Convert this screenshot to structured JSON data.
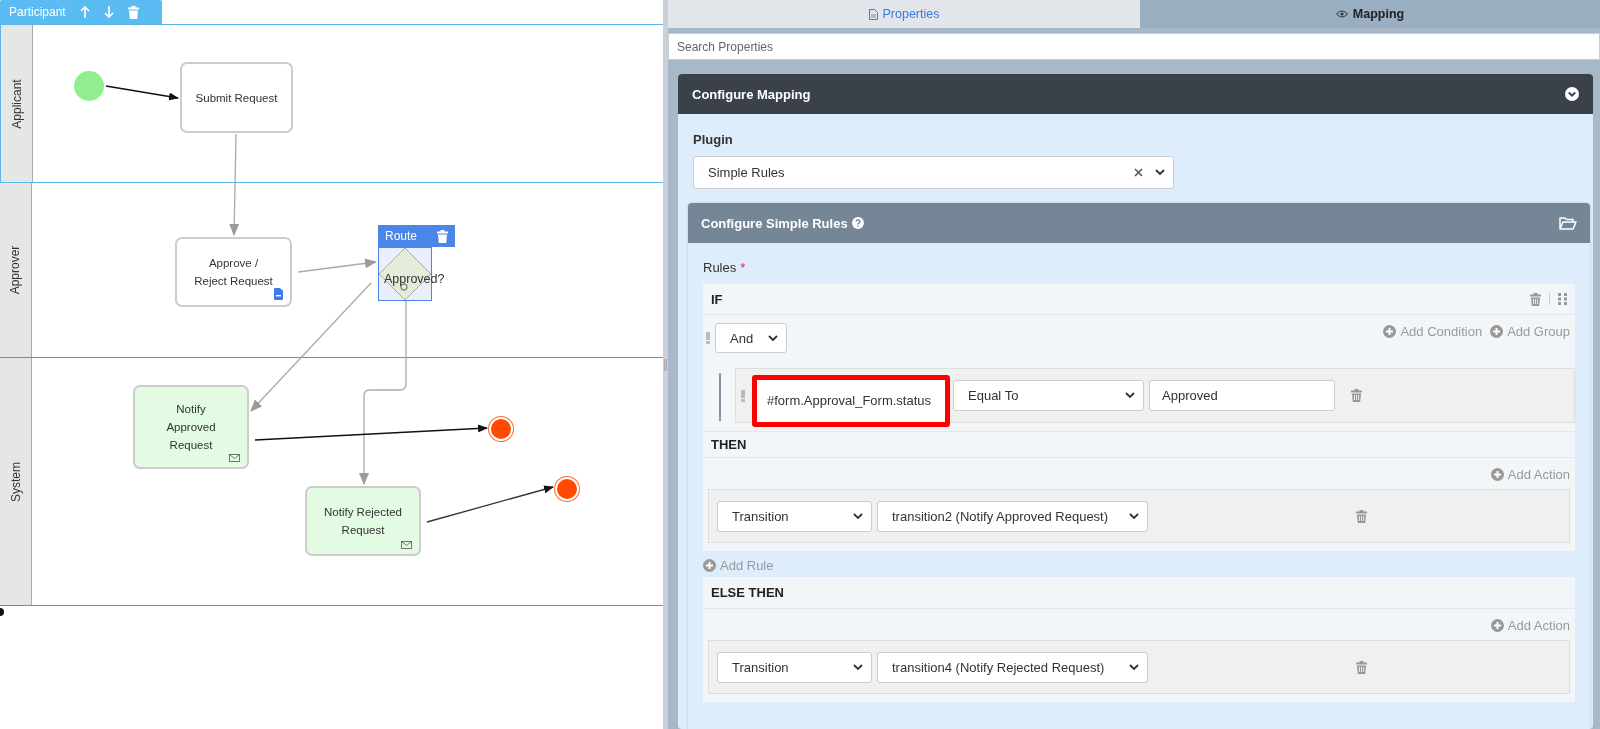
{
  "diagram": {
    "pool_toolbar": {
      "label": "Participant"
    },
    "lanes": [
      {
        "label": "Applicant",
        "selected": true
      },
      {
        "label": "Approver",
        "selected": false
      },
      {
        "label": "System",
        "selected": false
      }
    ],
    "nodes": [
      {
        "kind": "start"
      },
      {
        "kind": "user-task",
        "label": "Submit Request"
      },
      {
        "kind": "form-task",
        "label": "Approve / Reject Request"
      },
      {
        "kind": "gateway",
        "label": "Approved?",
        "selected": true,
        "toolbar_label": "Route"
      },
      {
        "kind": "mail-task",
        "label": "Notify Approved Request"
      },
      {
        "kind": "end"
      },
      {
        "kind": "mail-task",
        "label": "Notify Rejected Request"
      },
      {
        "kind": "end"
      }
    ]
  },
  "properties": {
    "tabs": [
      {
        "label": "Properties",
        "selected": false
      },
      {
        "label": "Mapping",
        "selected": true
      }
    ],
    "search": {
      "placeholder": "Search Properties"
    },
    "mapping": {
      "title": "Configure Mapping",
      "expanded": true,
      "plugin_label": "Plugin",
      "plugin": "Simple Rules",
      "rules_card": {
        "title": "Configure Simple Rules",
        "rules_label": "Rules",
        "required_mark": "*",
        "if": {
          "heading": "IF",
          "operator": "And",
          "add_condition": "Add Condition",
          "add_group": "Add Group",
          "conditions": [
            {
              "field": "#form.Approval_Form.status",
              "operator": "Equal To",
              "value": "Approved",
              "highlighted": true
            }
          ]
        },
        "then": {
          "heading": "THEN",
          "add_action": "Add Action",
          "actions": [
            {
              "type": "Transition",
              "target": "transition2 (Notify Approved Request)"
            }
          ]
        },
        "add_rule": "Add Rule",
        "else": {
          "heading": "ELSE THEN",
          "add_action": "Add Action",
          "actions": [
            {
              "type": "Transition",
              "target": "transition4 (Notify Rejected Request)"
            }
          ]
        }
      }
    }
  }
}
